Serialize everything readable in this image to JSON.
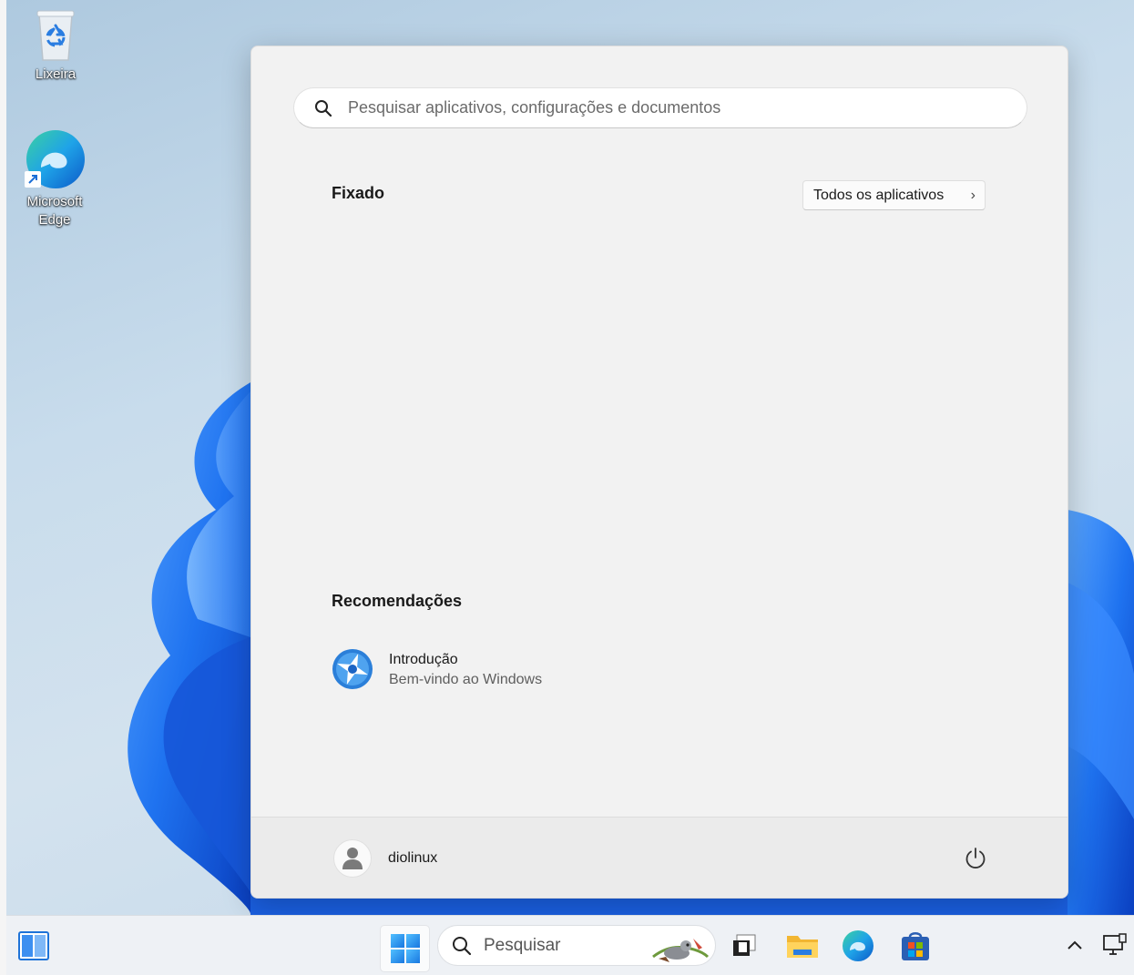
{
  "desktop": {
    "icons": [
      {
        "label": "Lixeira",
        "icon": "recycle-bin-icon"
      },
      {
        "label": "Microsoft\nEdge",
        "icon": "edge-icon"
      }
    ]
  },
  "start_menu": {
    "search": {
      "placeholder": "Pesquisar aplicativos, configurações e documentos"
    },
    "pinned": {
      "title": "Fixado",
      "all_apps_label": "Todos os aplicativos"
    },
    "recommended": {
      "title": "Recomendações",
      "items": [
        {
          "title": "Introdução",
          "subtitle": "Bem-vindo ao Windows",
          "icon": "get-started-icon"
        }
      ]
    },
    "user": {
      "name": "diolinux"
    },
    "power_icon": "power-icon"
  },
  "taskbar": {
    "search_label": "Pesquisar",
    "items": [
      "widgets-icon",
      "start-icon",
      "search-icon",
      "task-view-icon",
      "file-explorer-icon",
      "edge-icon",
      "store-icon",
      "chevron-up-icon",
      "network-icon"
    ]
  },
  "colors": {
    "accent": "#0078d4",
    "start_bg": "#f2f2f2",
    "taskbar_bg": "#eef1f5"
  }
}
